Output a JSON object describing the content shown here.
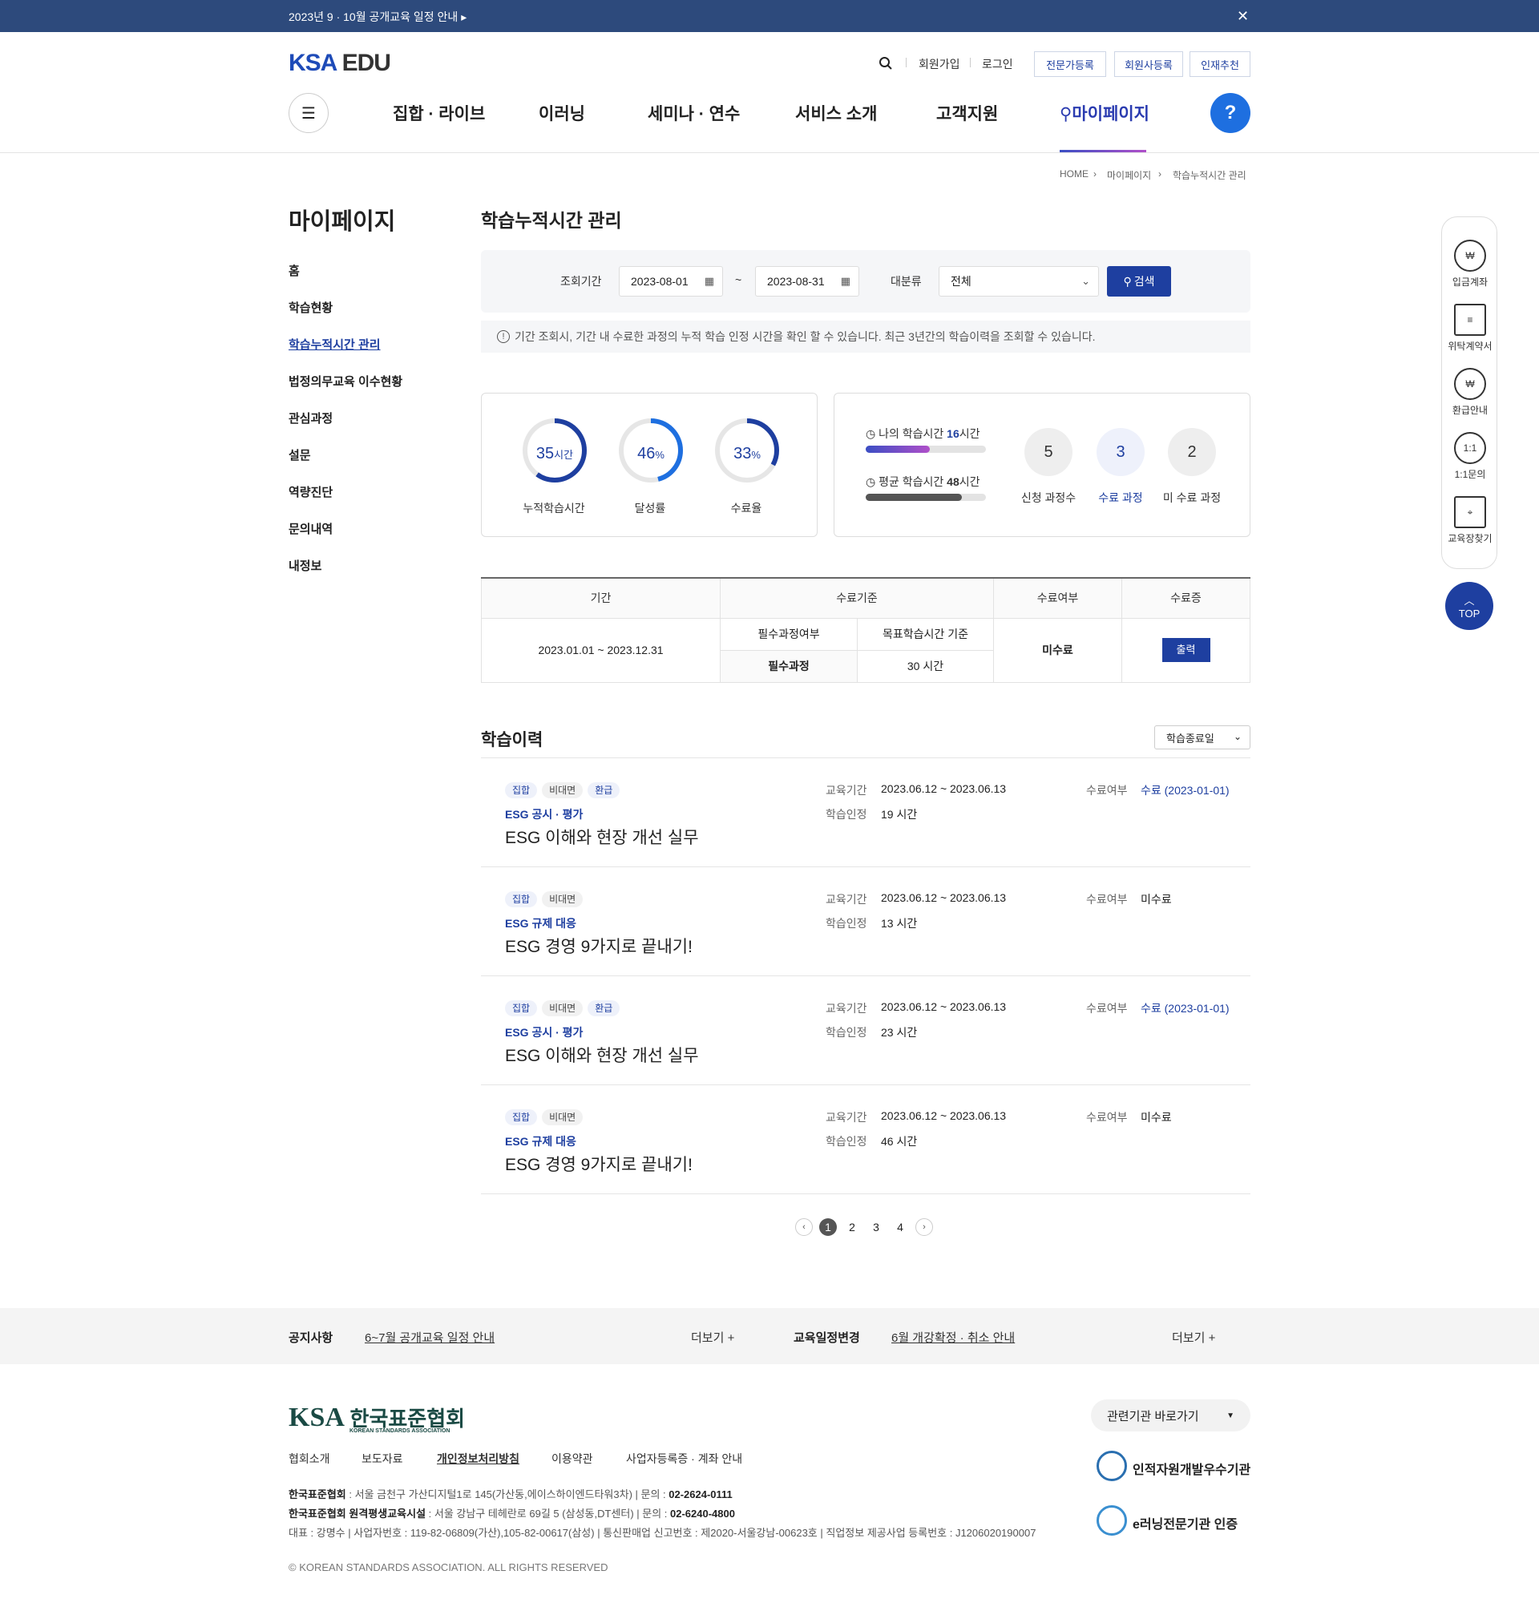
{
  "topbar": {
    "notice": "2023년 9 · 10월 공개교육 일정 안내 ▸",
    "close": "✕"
  },
  "header": {
    "logo_ksa": "KSA",
    "logo_edu": "EDU",
    "util": {
      "join": "회원가입",
      "login": "로그인",
      "btn1": "전문가등록",
      "btn2": "회원사등록",
      "btn3": "인재추천"
    },
    "gnb": [
      "집합 · 라이브",
      "이러닝",
      "세미나 · 연수",
      "서비스 소개",
      "고객지원",
      "마이페이지"
    ],
    "help": "?"
  },
  "breadcrumb": [
    "HOME",
    "마이페이지",
    "학습누적시간 관리"
  ],
  "lnb": {
    "title": "마이페이지",
    "items": [
      "홈",
      "학습현황",
      "학습누적시간 관리",
      "법정의무교육 이수현황",
      "관심과정",
      "설문",
      "역량진단",
      "문의내역",
      "내정보"
    ],
    "active": 2
  },
  "page_title": "학습누적시간 관리",
  "search": {
    "period_label": "조회기간",
    "from": "2023-08-01",
    "tilde": "~",
    "to": "2023-08-31",
    "cat_label": "대분류",
    "cat_value": "전체",
    "btn": "검색"
  },
  "notice": "기간 조회시, 기간 내 수료한 과정의 누적 학습 인정 시간을 확인 할 수 있습니다. 최근 3년간의 학습이력을 조회할 수 있습니다.",
  "stats": {
    "donuts": [
      {
        "value": "35",
        "unit": "시간",
        "label": "누적학습시간",
        "pct": 0.6
      },
      {
        "value": "46",
        "unit": "%",
        "label": "달성률",
        "pct": 0.46
      },
      {
        "value": "33",
        "unit": "%",
        "label": "수료율",
        "pct": 0.33
      }
    ],
    "my_label": "나의 학습시간",
    "my_value": "16",
    "my_unit": "시간",
    "my_pct": 0.53,
    "avg_label": "평균 학습시간",
    "avg_value": "48",
    "avg_unit": "시간",
    "avg_pct": 0.8,
    "counts": [
      {
        "value": "5",
        "label": "신청 과정수"
      },
      {
        "value": "3",
        "label": "수료 과정"
      },
      {
        "value": "2",
        "label": "미 수료 과정"
      }
    ]
  },
  "criteria_table": {
    "h_period": "기간",
    "h_criteria": "수료기준",
    "h_status": "수료여부",
    "h_cert": "수료증",
    "sub1": "필수과정여부",
    "sub2": "목표학습시간 기준",
    "period": "2023.01.01 ~ 2023.12.31",
    "required": "필수과정",
    "target": "30 시간",
    "status": "미수료",
    "print": "출력"
  },
  "history": {
    "title": "학습이력",
    "sort": "학습종료일",
    "k_period": "교육기간",
    "k_hours": "학습인정",
    "k_status": "수료여부",
    "items": [
      {
        "tags": [
          "집합",
          "비대면",
          "환급"
        ],
        "cat": "ESG 공시 · 평가",
        "title": "ESG 이해와 현장 개선 실무",
        "period": "2023.06.12 ~ 2023.06.13",
        "hours": "19 시간",
        "status": "수료 (2023-01-01)"
      },
      {
        "tags": [
          "집합",
          "비대면"
        ],
        "cat": "ESG 규제 대응",
        "title": "ESG 경영 9가지로 끝내기!",
        "period": "2023.06.12 ~ 2023.06.13",
        "hours": "13 시간",
        "status": "미수료"
      },
      {
        "tags": [
          "집합",
          "비대면",
          "환급"
        ],
        "cat": "ESG 공시 · 평가",
        "title": "ESG 이해와 현장 개선 실무",
        "period": "2023.06.12 ~ 2023.06.13",
        "hours": "23 시간",
        "status": "수료 (2023-01-01)"
      },
      {
        "tags": [
          "집합",
          "비대면"
        ],
        "cat": "ESG 규제 대응",
        "title": "ESG 경영 9가지로 끝내기!",
        "period": "2023.06.12 ~ 2023.06.13",
        "hours": "46 시간",
        "status": "미수료"
      }
    ]
  },
  "pager": {
    "prev": "‹",
    "pages": [
      "1",
      "2",
      "3",
      "4"
    ],
    "next": "›",
    "current": 1
  },
  "quick": {
    "items": [
      "입금계좌",
      "위탁계약서",
      "환급안내",
      "1:1문의",
      "교육장찾기"
    ],
    "icon_1on1": "1:1",
    "top": "TOP"
  },
  "notice_bar": {
    "k1": "공지사항",
    "v1": "6~7월 공개교육 일정 안내",
    "more": "더보기 +",
    "k2": "교육일정변경",
    "v2": "6월 개강확정 · 취소 안내"
  },
  "footer": {
    "logo": "KSA",
    "logo_kr": "한국표준협회",
    "logo_en": "KOREAN STANDARDS ASSOCIATION",
    "select": "관련기관 바로가기",
    "links": [
      "협회소개",
      "보도자료",
      "개인정보처리방침",
      "이용약관",
      "사업자등록증 · 계좌 안내"
    ],
    "line1_b": "한국표준협회",
    "line1": " : 서울 금천구 가산디지털1로 145(가산동,에이스하이엔드타워3차)   |   문의 : ",
    "line1_tel": "02-2624-0111",
    "line2_b": "한국표준협회 원격평생교육시설",
    "line2": " : 서울 강남구 테헤란로 69길 5 (삼성동,DT센터)   |   문의 : ",
    "line2_tel": "02-6240-4800",
    "line3": "대표 : 강명수   |   사업자번호 : 119-82-06809(가산),105-82-00617(삼성)   |   통신판매업 신고번호 : 제2020-서울강남-00623호   |   직업정보 제공사업 등록번호 : J1206020190007",
    "cert1": "인적자원개발우수기관",
    "cert2": "e러닝전문기관 인증",
    "copy": "© KOREAN STANDARDS ASSOCIATION. ALL RIGHTS RESERVED"
  }
}
